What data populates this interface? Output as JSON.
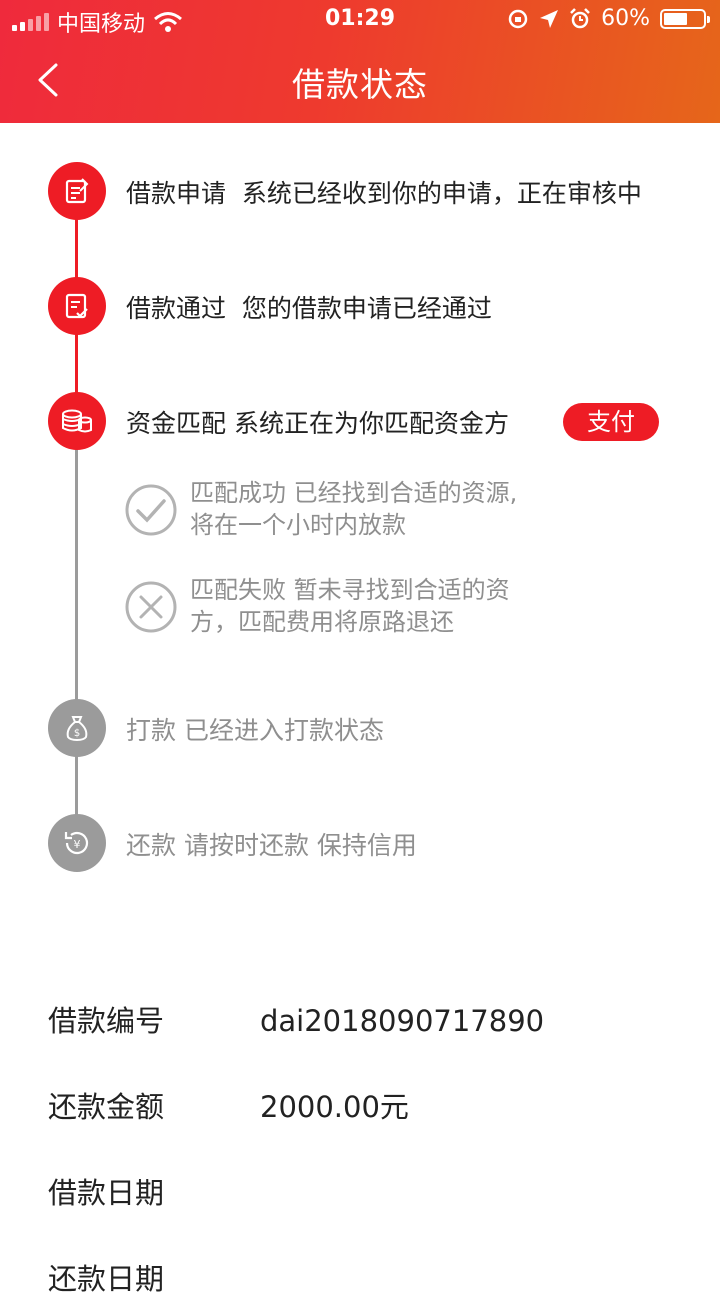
{
  "status_bar": {
    "carrier": "中国移动",
    "time": "01:29",
    "battery": "60%",
    "battery_level": 0.6
  },
  "nav": {
    "title": "借款状态"
  },
  "steps": [
    {
      "title": "借款申请",
      "desc": "系统已经收到你的申请，正在审核中",
      "state": "done",
      "icon": "application-form-icon"
    },
    {
      "title": "借款通过",
      "desc": "您的借款申请已经通过",
      "state": "done",
      "icon": "approved-document-icon"
    },
    {
      "title": "资金匹配",
      "desc": "系统正在为你匹配资金方",
      "state": "current",
      "icon": "coin-stack-icon",
      "button": "支付"
    },
    {
      "title": "打款",
      "desc": "已经进入打款状态",
      "state": "pending",
      "icon": "money-bag-icon"
    },
    {
      "title": "还款",
      "desc": "请按时还款 保持信用",
      "state": "pending",
      "icon": "repay-yuan-icon"
    }
  ],
  "match_results": [
    {
      "lines": [
        "匹配成功 已经找到合适的资源,",
        "将在一个小时内放款"
      ],
      "icon": "check-circle-icon"
    },
    {
      "lines": [
        "匹配失败 暂未寻找到合适的资",
        "方，匹配费用将原路退还"
      ],
      "icon": "cross-circle-icon"
    }
  ],
  "info": [
    {
      "label": "借款编号",
      "value": "dai2018090717890"
    },
    {
      "label": "还款金额",
      "value": "2000.00元"
    },
    {
      "label": "借款日期",
      "value": ""
    },
    {
      "label": "还款日期",
      "value": ""
    }
  ],
  "colors": {
    "accent": "#ee1c25",
    "header_start": "#ef2a3c",
    "header_end": "#e6661a",
    "inactive": "#9b9b9b"
  }
}
